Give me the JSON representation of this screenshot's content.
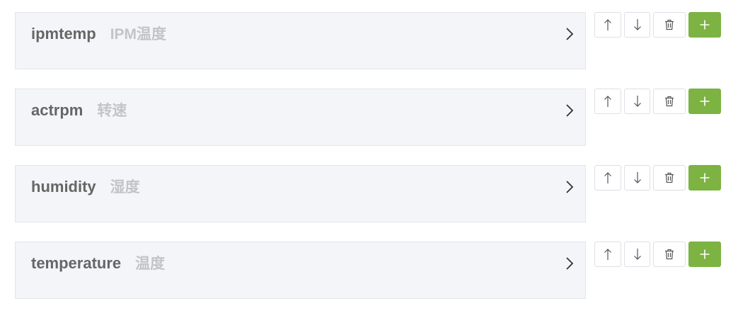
{
  "fields": [
    {
      "key": "ipmtemp",
      "label": "IPM温度"
    },
    {
      "key": "actrpm",
      "label": "转速"
    },
    {
      "key": "humidity",
      "label": "湿度"
    },
    {
      "key": "temperature",
      "label": "温度"
    }
  ],
  "icons": {
    "expand": "chevron-right-icon",
    "move_up": "arrow-up-icon",
    "move_down": "arrow-down-icon",
    "delete": "trash-icon",
    "add": "plus-icon"
  },
  "colors": {
    "panel_background": "#f4f5f9",
    "key_text": "#666666",
    "label_text": "#c2c4c8",
    "add_button": "#7cb342"
  }
}
